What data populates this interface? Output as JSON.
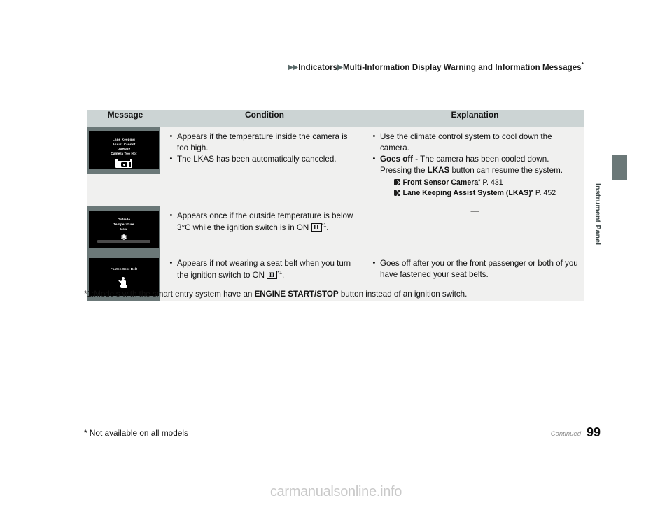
{
  "header": {
    "breadcrumb_arrow": "▶",
    "crumb1": "Indicators",
    "crumb2": "Multi-Information Display Warning and Information Messages",
    "crumb_star": "*"
  },
  "side_tab": {
    "label": "Instrument Panel"
  },
  "table": {
    "columns": [
      "Message",
      "Condition",
      "Explanation"
    ],
    "rows": [
      {
        "display": {
          "lines": [
            "Lane Keeping",
            "Assist Cannot",
            "Operate",
            "Camera Too Hot"
          ],
          "icon": "camera-too-hot-icon"
        },
        "condition": [
          "Appears if the temperature inside the camera is too high.",
          "The LKAS has been automatically canceled."
        ],
        "explanation": {
          "bullets": [
            {
              "text": "Use the climate control system to cool down the camera."
            },
            {
              "lead": "Goes off",
              "text": " - The camera has been cooled down. Pressing the ",
              "bold_mid": "LKAS",
              "text_tail": " button can resume the system."
            }
          ],
          "refs": [
            {
              "icon": "reference-arrow-icon",
              "name": "Front Sensor Camera",
              "star": "*",
              "page": "P. 431"
            },
            {
              "icon": "reference-arrow-icon",
              "name": "Lane Keeping Assist System (LKAS)",
              "star": "*",
              "page": "P. 452"
            }
          ]
        }
      },
      {
        "display": {
          "lines": [
            "Outside",
            "Temperature",
            "Low"
          ],
          "icon": "snowflake-icon"
        },
        "condition_rich": {
          "pre": "Appears once if the outside temperature is below 3°C while the ignition switch is in ON ",
          "ignition_glyph": "II",
          "footnote_mark": "*1",
          "post": "."
        },
        "explanation_dash": "—"
      },
      {
        "display": {
          "lines": [
            "Fasten Seat Belt"
          ],
          "icon": "seat-belt-icon"
        },
        "condition_rich": {
          "pre": "Appears if not wearing a seat belt when you turn the ignition switch to ON ",
          "ignition_glyph": "II",
          "footnote_mark": "*1",
          "post": "."
        },
        "explanation": {
          "bullets": [
            {
              "text": "Goes off after you or the front passenger or both of you have fastened your seat belts."
            }
          ]
        }
      }
    ]
  },
  "footnote": {
    "mark": "*1:",
    "pre": "Models with the smart entry system have an ",
    "bold": "ENGINE START/STOP",
    "post": " button instead of an ignition switch."
  },
  "footer": {
    "note": "* Not available on all models",
    "continued": "Continued",
    "page_number": "99"
  },
  "watermark": {
    "text": "carmanualsonline.info"
  },
  "colors": {
    "header_fill": "#ccd4d4",
    "cell_fill": "#f0f0ef",
    "display_frame": "#6b7878",
    "display_screen": "#000000",
    "side_tab": "#6b7878",
    "rule": "#b9b9b9"
  }
}
